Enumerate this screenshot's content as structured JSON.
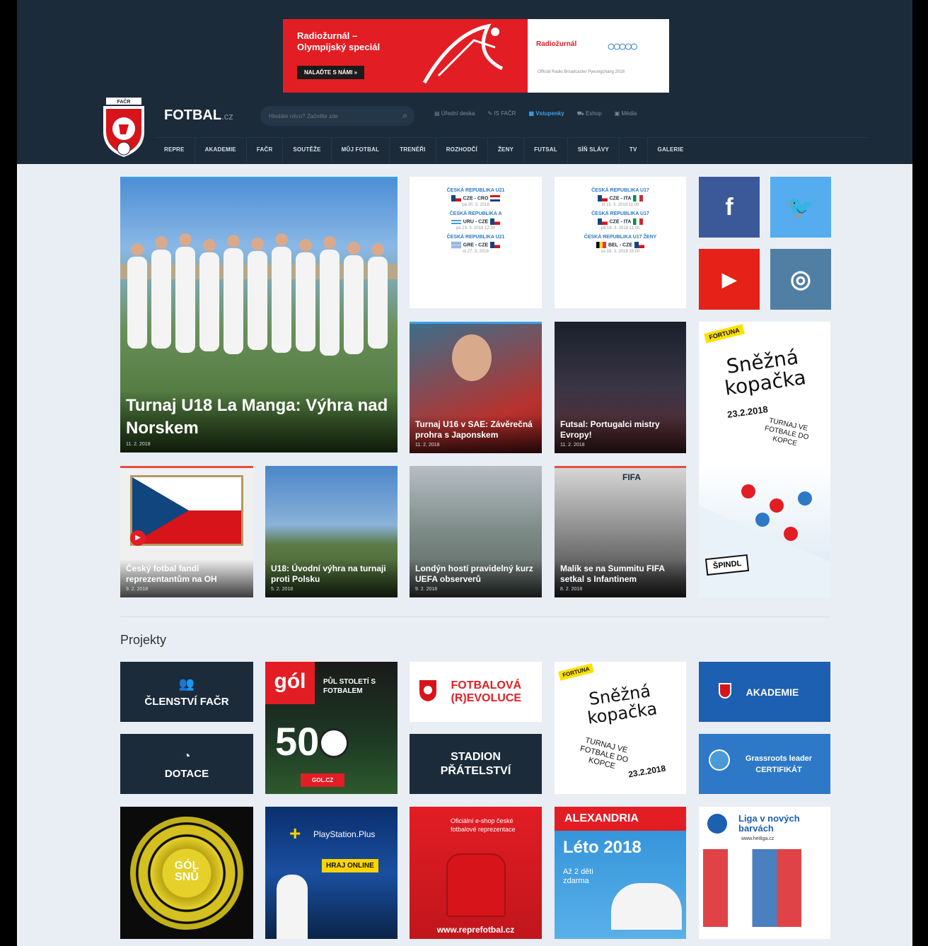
{
  "banner": {
    "title": "Radiožurnál – Olympijský speciál",
    "button": "NALAĎTE S NÁMI »",
    "brand": "Radiožurnál",
    "small": "Official Radio Broadcaster Pyeongchang 2018"
  },
  "site": {
    "name": "FOTBAL",
    "tld": ".cz"
  },
  "search": {
    "placeholder": "Hledáte něco? Začněte zde"
  },
  "top_links": [
    "Úřední deska",
    "IS FAČR",
    "Vstupenky",
    "Eshop",
    "Média"
  ],
  "nav": [
    "REPRE",
    "AKADEMIE",
    "FAČR",
    "SOUTĚŽE",
    "MŮJ FOTBAL",
    "TRENÉŘI",
    "ROZHODČÍ",
    "ŽENY",
    "FUTSAL",
    "SÍŇ SLÁVY",
    "TV",
    "GALERIE"
  ],
  "hero": {
    "title": "Turnaj U18 La Manga: Výhra nad Norskem",
    "date": "11. 2. 2018"
  },
  "matches_left": [
    {
      "title": "ČESKÁ REPUBLIKA U21",
      "score": "CZE - CRO",
      "date": "pá 20. 3. 2018"
    },
    {
      "title": "ČESKÁ REPUBLIKA A",
      "score": "URU - CZE",
      "date": "pá 23. 3. 2018 12:30"
    },
    {
      "title": "ČESKÁ REPUBLIKA U21",
      "score": "GRE - CZE",
      "date": "út 27. 3. 2018"
    }
  ],
  "matches_right": [
    {
      "title": "ČESKÁ REPUBLIKA U17",
      "score": "CZE - ITA",
      "date": "čt 15. 3. 2018 11:00"
    },
    {
      "title": "ČESKÁ REPUBLIKA U17",
      "score": "CZE - ITA",
      "date": "pá 16. 3. 2018 11:00"
    },
    {
      "title": "ČESKÁ REPUBLIKA U17 ŽENY",
      "score": "BEL - CZE",
      "date": "so 18. 3. 2018 15:00"
    }
  ],
  "news": [
    {
      "title": "Turnaj U16 v SAE: Závěrečná prohra s Japonskem",
      "date": "11. 2. 2018"
    },
    {
      "title": "Futsal: Portugalci mistry Evropy!",
      "date": "11. 2. 2018"
    },
    {
      "title": "Český fotbal fandí reprezentantům na OH",
      "date": "9. 2. 2018"
    },
    {
      "title": "U18: Úvodní výhra na turnaji proti Polsku",
      "date": "5. 2. 2018"
    },
    {
      "title": "Londýn hostí pravidelný kurz UEFA observerů",
      "date": "9. 2. 2018"
    },
    {
      "title": "Malík se na Summitu FIFA setkal s Infantinem",
      "date": "8. 2. 2018"
    }
  ],
  "social": {
    "facebook": "f",
    "twitter": "🐦",
    "youtube": "▶",
    "instagram": "◎"
  },
  "ad_snezna": {
    "brand": "FORTUNA",
    "title": "Sněžná kopačka",
    "date": "23.2.2018",
    "sub": "TURNAJ VE FOTBALE DO KOPCE",
    "place": "ŠPINDL"
  },
  "projects": {
    "title": "Projekty",
    "clenstvi": "ČLENSTVÍ FAČR",
    "dotace": "DOTACE",
    "gol": "gól",
    "gol_sub": "PŮL STOLETÍ S FOTBALEM",
    "gol_50": "50",
    "gol_url": "GOL.CZ",
    "revoluce": "FOTBALOVÁ (R)EVOLUCE",
    "stadion": "STADION PŘÁTELSTVÍ",
    "snezna2": "Sněžná kopačka",
    "akademie": "AKADEMIE",
    "grassroots": "Grassroots leader CERTIFIKÁT",
    "golsnu": "GÓL SNŮ",
    "ps": "PlayStation.Plus",
    "ps_btn": "HRAJ ONLINE",
    "eshop": "Oficiální e-shop české fotbalové reprezentace",
    "eshop_url": "www.reprefotbal.cz",
    "alexandria": "ALEXANDRIA",
    "leto": "Léto 2018",
    "leto_sub": "Až 2 děti zdarma",
    "liga": "Liga v nových barvách",
    "liga_url": "www.hetliga.cz"
  },
  "colors": {
    "header": "#1b2b3a",
    "accent": "#3ea0e6",
    "red": "#e31d24",
    "page": "#e9eef4"
  }
}
